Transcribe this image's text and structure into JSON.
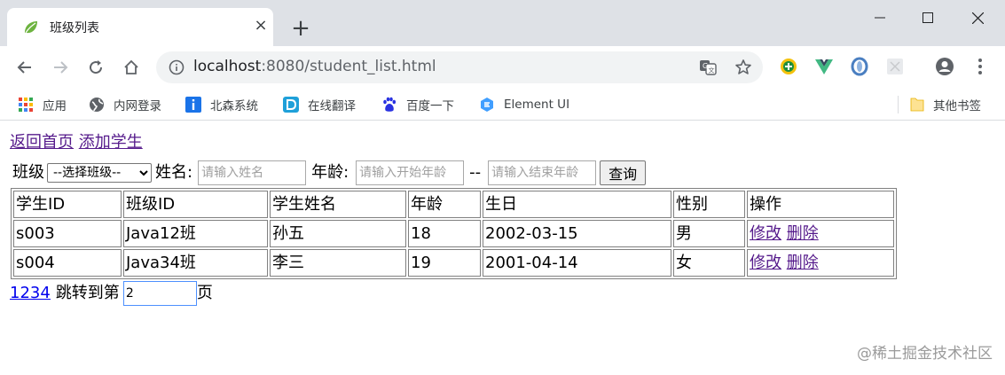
{
  "browser": {
    "tab_title": "班级列表",
    "tab_close": "×",
    "new_tab": "+",
    "url_host": "localhost",
    "url_path": ":8080/student_list.html"
  },
  "bookmarks": [
    {
      "label": "应用",
      "icon": "apps-grid-icon"
    },
    {
      "label": "内网登录",
      "icon": "globe-icon"
    },
    {
      "label": "北森系统",
      "icon": "info-icon"
    },
    {
      "label": "在线翻译",
      "icon": "translate-d-icon"
    },
    {
      "label": "百度一下",
      "icon": "baidu-paw-icon"
    },
    {
      "label": "Element UI",
      "icon": "element-icon"
    }
  ],
  "other_bookmarks": "其他书签",
  "page": {
    "nav": {
      "home": "返回首页",
      "add_student": "添加学生"
    },
    "search": {
      "class_label": "班级",
      "class_select": "--选择班级--",
      "name_label": "姓名:",
      "name_placeholder": "请输入姓名",
      "age_label": "年龄:",
      "age_start_placeholder": "请输入开始年龄",
      "separator": "--",
      "age_end_placeholder": "请输入结束年龄",
      "query_button": "查询"
    },
    "table": {
      "headers": [
        "学生ID",
        "班级ID",
        "学生姓名",
        "年龄",
        "生日",
        "性别",
        "操作"
      ],
      "rows": [
        {
          "id": "s003",
          "class": "Java12班",
          "name": "孙五",
          "age": "18",
          "birthday": "2002-03-15",
          "gender": "男",
          "edit": "修改",
          "delete": "删除"
        },
        {
          "id": "s004",
          "class": "Java34班",
          "name": "李三",
          "age": "19",
          "birthday": "2001-04-14",
          "gender": "女",
          "edit": "修改",
          "delete": "删除"
        }
      ]
    },
    "pager": {
      "pages": [
        "1",
        "2",
        "3",
        "4"
      ],
      "jump_prefix": "跳转到第",
      "jump_value": "2",
      "jump_suffix": "页"
    }
  },
  "watermark": "@稀土掘金技术社区",
  "colors": {
    "visited_link": "#551a8b",
    "link": "#0000ee",
    "chrome_bg": "#dee1e6"
  }
}
